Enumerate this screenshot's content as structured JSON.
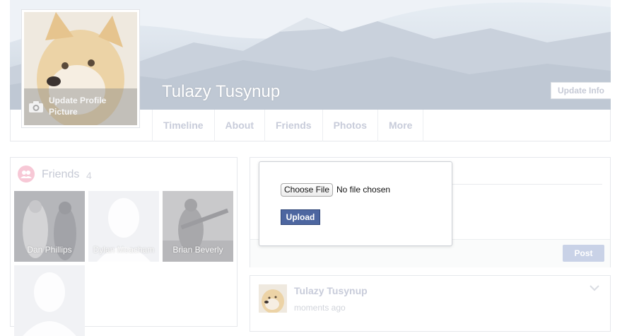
{
  "profile": {
    "name": "Tulazy Tusynup",
    "update_info_label": "Update Info",
    "update_picture_label": "Update Profile Picture"
  },
  "nav": {
    "tabs": [
      "Timeline",
      "About",
      "Friends",
      "Photos",
      "More"
    ]
  },
  "friends": {
    "title": "Friends",
    "count": "4",
    "items": [
      {
        "name": "Dan Phillips"
      },
      {
        "name": "Dylan Meacham"
      },
      {
        "name": "Brian Beverly"
      },
      {
        "name": ""
      }
    ]
  },
  "upload_dialog": {
    "choose_file_label": "Choose File",
    "file_status": "No file chosen",
    "upload_label": "Upload"
  },
  "composer": {
    "post_label": "Post"
  },
  "feed": {
    "post": {
      "author": "Tulazy Tusynup",
      "time": "moments ago"
    }
  },
  "icons": {
    "camera": "camera-icon",
    "friends": "friends-icon",
    "chevron": "chevron-down-icon"
  }
}
